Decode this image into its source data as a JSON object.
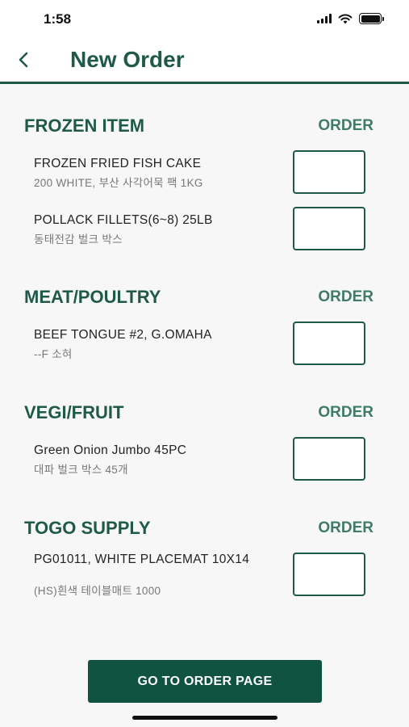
{
  "status_bar": {
    "time": "1:58"
  },
  "header": {
    "back_icon": "chevron-left-icon",
    "title": "New Order"
  },
  "sections": [
    {
      "title": "FROZEN ITEM",
      "order_label": "ORDER",
      "items": [
        {
          "name": "FROZEN FRIED FISH CAKE",
          "description": "200 WHITE, 부산 사각어묵 팩 1KG",
          "quantity": ""
        },
        {
          "name": "POLLACK FILLETS(6~8) 25LB",
          "description": "동태전감 벌크 박스",
          "quantity": ""
        }
      ]
    },
    {
      "title": "MEAT/POULTRY",
      "order_label": "ORDER",
      "items": [
        {
          "name": "BEEF TONGUE #2, G.OMAHA",
          "description": "--F 소혀",
          "quantity": ""
        }
      ]
    },
    {
      "title": "VEGI/FRUIT",
      "order_label": "ORDER",
      "items": [
        {
          "name": "Green Onion Jumbo 45PC",
          "description": "대파 벌크 박스  45개",
          "quantity": ""
        }
      ]
    },
    {
      "title": "TOGO SUPPLY",
      "order_label": "ORDER",
      "items": [
        {
          "name": "PG01011,  WHITE PLACEMAT 10X14",
          "description": "(HS)흰색 테이블매트 1000",
          "quantity": ""
        }
      ]
    }
  ],
  "footer": {
    "button_label": "GO TO ORDER PAGE"
  },
  "colors": {
    "primary": "#1f5a48",
    "button": "#0f5340",
    "order_label": "#3f7b66"
  }
}
